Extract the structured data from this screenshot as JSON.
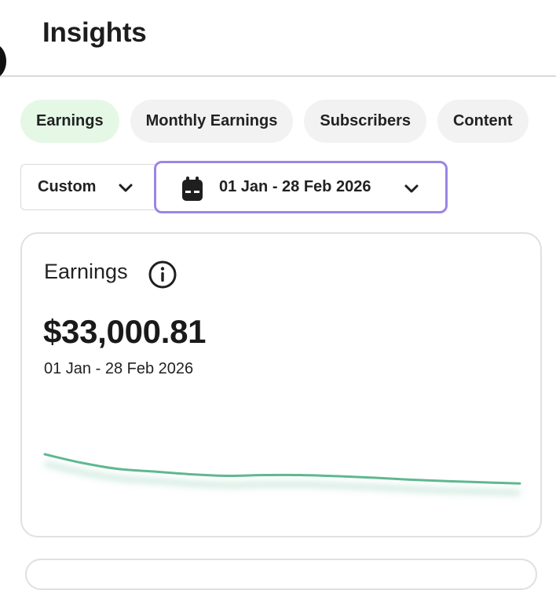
{
  "header": {
    "title": "Insights"
  },
  "tabs": [
    {
      "label": "Earnings",
      "active": true
    },
    {
      "label": "Monthly Earnings",
      "active": false
    },
    {
      "label": "Subscribers",
      "active": false
    },
    {
      "label": "Content",
      "active": false
    }
  ],
  "filters": {
    "range_label": "Custom",
    "date_range": "01 Jan - 28 Feb 2026"
  },
  "earnings_card": {
    "title": "Earnings",
    "amount": "$33,000.81",
    "period": "01 Jan - 28 Feb 2026"
  },
  "colors": {
    "accent_line": "#5fb88f",
    "active_tab_bg": "#e5f8e6",
    "focus_border": "#9b85e6"
  },
  "icons": {
    "back": "back-icon",
    "calendar": "calendar-icon",
    "chevron": "chevron-down-icon",
    "info": "info-icon"
  },
  "chart_data": {
    "type": "line",
    "series": [
      {
        "values": [
          1.0,
          0.78,
          0.62,
          0.55,
          0.48,
          0.44,
          0.46,
          0.46,
          0.43,
          0.39,
          0.34,
          0.3,
          0.27,
          0.24
        ]
      }
    ],
    "grid": false
  }
}
